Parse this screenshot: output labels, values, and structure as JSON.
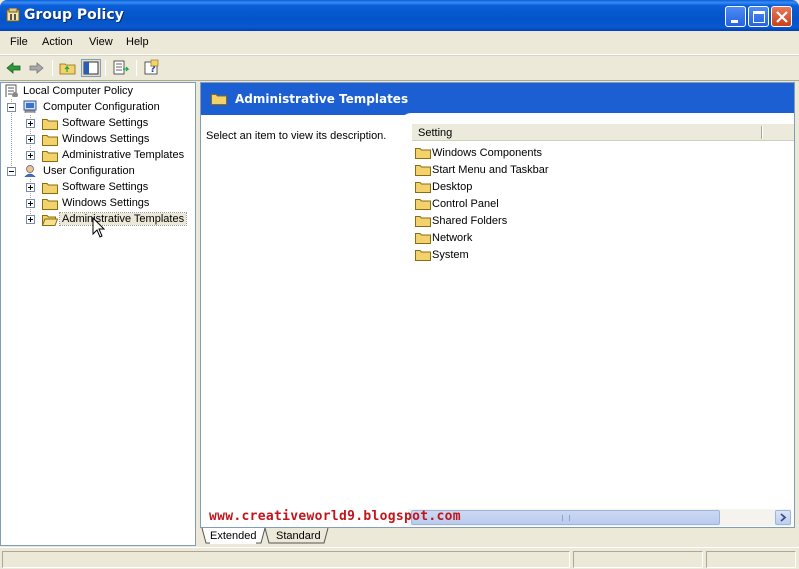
{
  "window": {
    "title": "Group Policy",
    "controls": [
      "minimize",
      "maximize",
      "close"
    ]
  },
  "menu": {
    "items": [
      "File",
      "Action",
      "View",
      "Help"
    ]
  },
  "toolbar": {
    "buttons": [
      "back-arrow-icon",
      "forward-arrow-icon",
      "up-folder-icon",
      "show-hide-tree-icon",
      "export-list-icon",
      "help-icon"
    ]
  },
  "tree": {
    "root": "Local Computer Policy",
    "nodes": [
      {
        "label": "Computer Configuration",
        "children": [
          "Software Settings",
          "Windows Settings",
          "Administrative Templates"
        ]
      },
      {
        "label": "User Configuration",
        "children": [
          "Software Settings",
          "Windows Settings",
          "Administrative Templates"
        ]
      }
    ],
    "selected": "Administrative Templates"
  },
  "right_panel": {
    "header_title": "Administrative Templates",
    "description": "Select an item to view its description.",
    "column_header": "Setting",
    "items": [
      "Windows Components",
      "Start Menu and Taskbar",
      "Desktop",
      "Control Panel",
      "Shared Folders",
      "Network",
      "System"
    ]
  },
  "tabs": {
    "extended": "Extended",
    "standard": "Standard",
    "active": "Extended"
  },
  "watermark": "www.creativeworld9.blogspot.com",
  "colors": {
    "titlebar": "#0a5fd8",
    "panel_header": "#1b5fd3",
    "watermark": "#c0161b",
    "folder": "#f3d16b"
  }
}
